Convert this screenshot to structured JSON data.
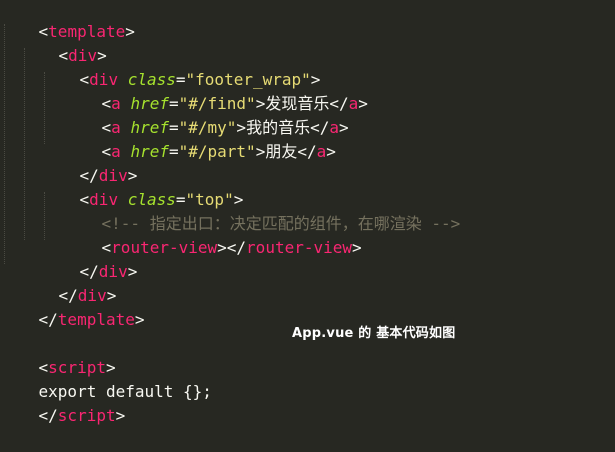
{
  "caption": "App.vue 的 基本代码如图",
  "code": {
    "l1_tag": "template",
    "l2_tag": "div",
    "l3_tag": "div",
    "l3_attr": "class",
    "l3_val": "\"footer_wrap\"",
    "l4_tag": "a",
    "l4_attr": "href",
    "l4_val": "\"#/find\"",
    "l4_text": "发现音乐",
    "l5_tag": "a",
    "l5_attr": "href",
    "l5_val": "\"#/my\"",
    "l5_text": "我的音乐",
    "l6_tag": "a",
    "l6_attr": "href",
    "l6_val": "\"#/part\"",
    "l6_text": "朋友",
    "l7_tag": "div",
    "l8_tag": "div",
    "l8_attr": "class",
    "l8_val": "\"top\"",
    "l9_comment": "<!-- 指定出口：决定匹配的组件，在哪渲染 -->",
    "l10_tag": "router-view",
    "l11_tag": "div",
    "l12_tag": "div",
    "l13_tag": "template",
    "l15_tag": "script",
    "l16_code": "export default {};",
    "l17_tag": "script"
  }
}
